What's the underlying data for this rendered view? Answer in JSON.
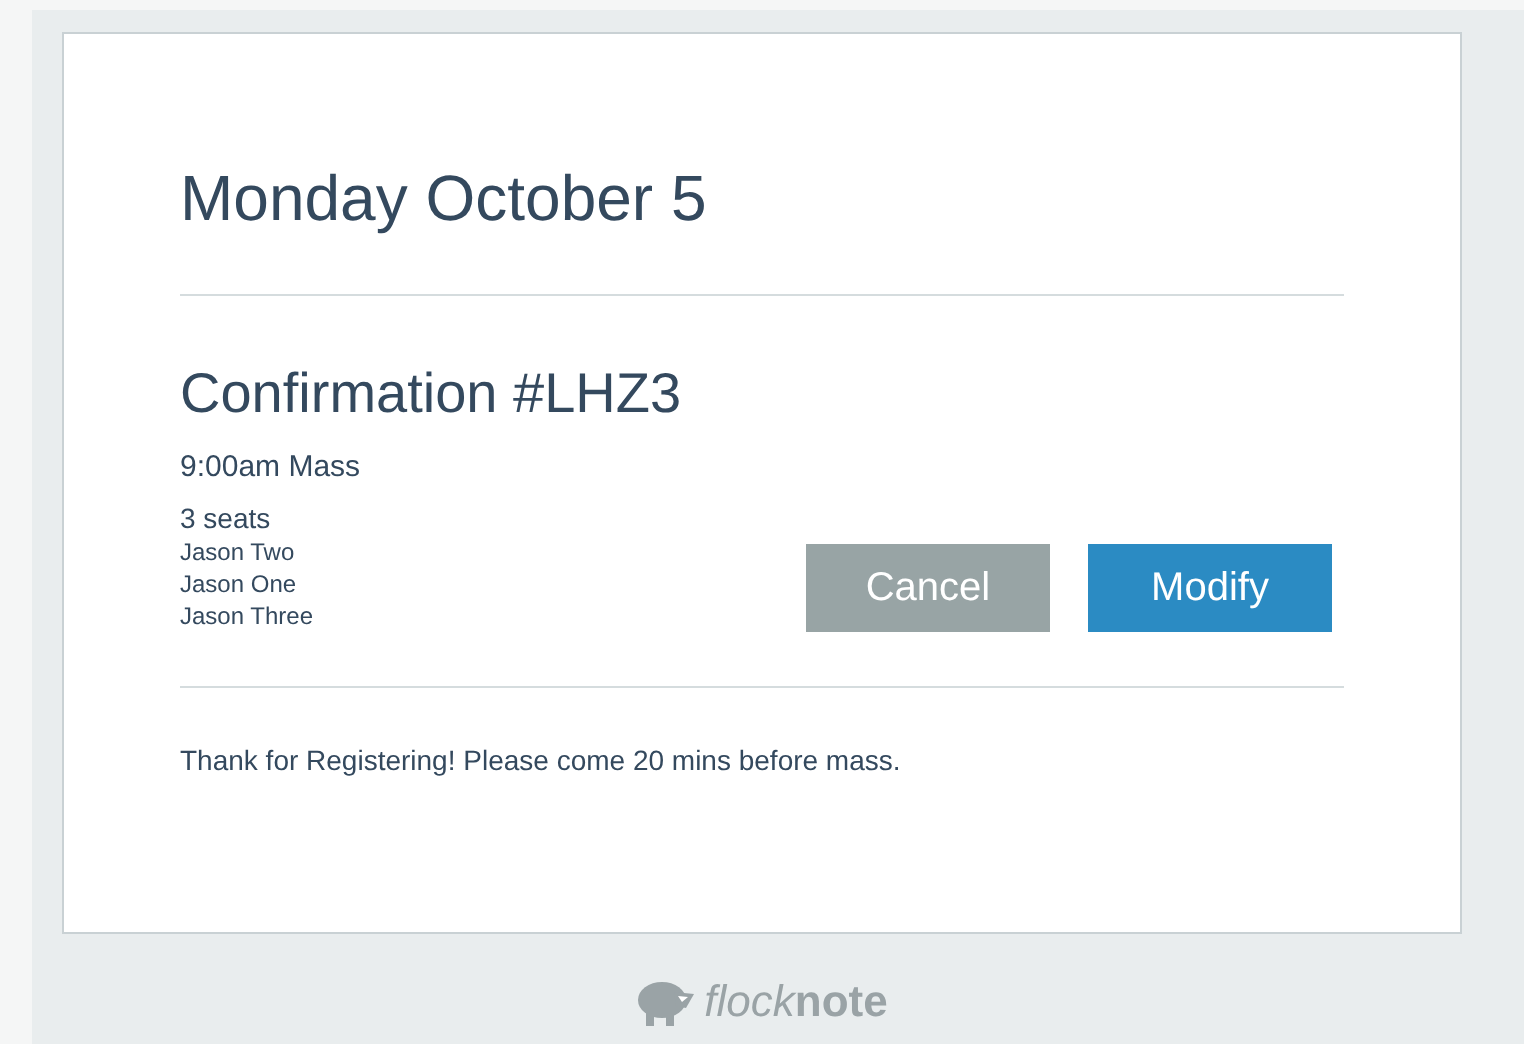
{
  "date_heading": "Monday October 5",
  "confirmation": {
    "title": "Confirmation #LHZ3",
    "service": "9:00am Mass",
    "seats": "3 seats",
    "attendees": [
      "Jason Two",
      "Jason One",
      "Jason Three"
    ]
  },
  "buttons": [
    {
      "label": "Cancel",
      "kind": "secondary"
    },
    {
      "label": "Modify",
      "kind": "primary"
    }
  ],
  "message": "Thank for Registering! Please come 20 mins before mass.",
  "footer_logo": {
    "light": "flock",
    "bold": "note"
  }
}
